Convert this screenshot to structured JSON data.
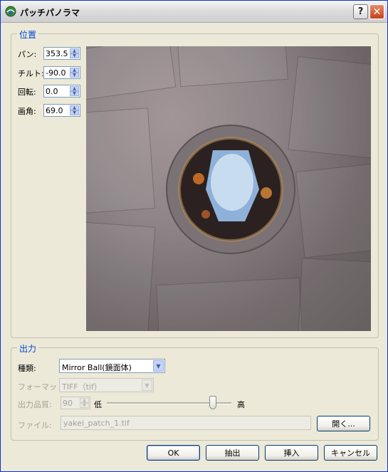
{
  "window": {
    "title": "パッチパノラマ",
    "help": "?",
    "close": "✕"
  },
  "position": {
    "title": "位置",
    "pan": {
      "label": "パン:",
      "value": "353.5"
    },
    "tilt": {
      "label": "チルト:",
      "value": "-90.0"
    },
    "rotate": {
      "label": "回転:",
      "value": "0.0"
    },
    "angle": {
      "label": "画角:",
      "value": "69.0"
    }
  },
  "output": {
    "title": "出力",
    "kind": {
      "label": "種類:",
      "value": "Mirror Ball(鏡面体)"
    },
    "format": {
      "label": "フォーマット:",
      "value": "TIFF（tif）"
    },
    "quality": {
      "label": "出力品質:",
      "value": "90",
      "low": "低",
      "high": "高",
      "level": 0.85
    },
    "file": {
      "label": "ファイル:",
      "value": "yakei_patch_1.tif",
      "open": "開く..."
    }
  },
  "buttons": {
    "ok": "OK",
    "extract": "抽出",
    "insert": "挿入",
    "cancel": "キャンセル"
  }
}
